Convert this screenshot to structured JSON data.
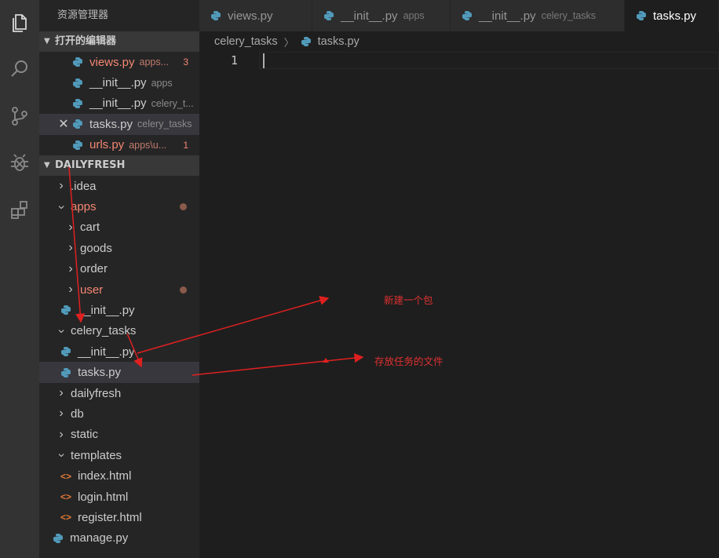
{
  "sidebar": {
    "title": "资源管理器",
    "open_editors": {
      "header": "打开的编辑器",
      "items": [
        {
          "name": "views.py",
          "desc": "apps...",
          "badge": "3",
          "error": true
        },
        {
          "name": "__init__.py",
          "desc": "apps",
          "badge": "",
          "error": false
        },
        {
          "name": "__init__.py",
          "desc": "celery_t...",
          "badge": "",
          "error": false
        },
        {
          "name": "tasks.py",
          "desc": "celery_tasks",
          "badge": "",
          "error": false
        },
        {
          "name": "urls.py",
          "desc": "apps\\u...",
          "badge": "1",
          "error": true
        }
      ]
    },
    "project": {
      "header": "DAILYFRESH",
      "items": [
        {
          "label": ".idea"
        },
        {
          "label": "apps"
        },
        {
          "label": "cart"
        },
        {
          "label": "goods"
        },
        {
          "label": "order"
        },
        {
          "label": "user"
        },
        {
          "label": "__init__.py"
        },
        {
          "label": "celery_tasks"
        },
        {
          "label": "__init__.py"
        },
        {
          "label": "tasks.py"
        },
        {
          "label": "dailyfresh"
        },
        {
          "label": "db"
        },
        {
          "label": "static"
        },
        {
          "label": "templates"
        },
        {
          "label": "index.html"
        },
        {
          "label": "login.html"
        },
        {
          "label": "register.html"
        },
        {
          "label": "manage.py"
        }
      ]
    }
  },
  "tabs": [
    {
      "name": "views.py",
      "desc": ""
    },
    {
      "name": "__init__.py",
      "desc": "apps"
    },
    {
      "name": "__init__.py",
      "desc": "celery_tasks"
    },
    {
      "name": "tasks.py",
      "desc": ""
    }
  ],
  "breadcrumb": {
    "folder": "celery_tasks",
    "file": "tasks.py"
  },
  "editor": {
    "line_number": "1"
  },
  "annotations": {
    "new_package": "新建一个包",
    "task_file": "存放任务的文件",
    "color": "#e02020"
  },
  "colors": {
    "error_text": "#f48771",
    "python_icon": "#519aba",
    "html_icon": "#e37933"
  }
}
